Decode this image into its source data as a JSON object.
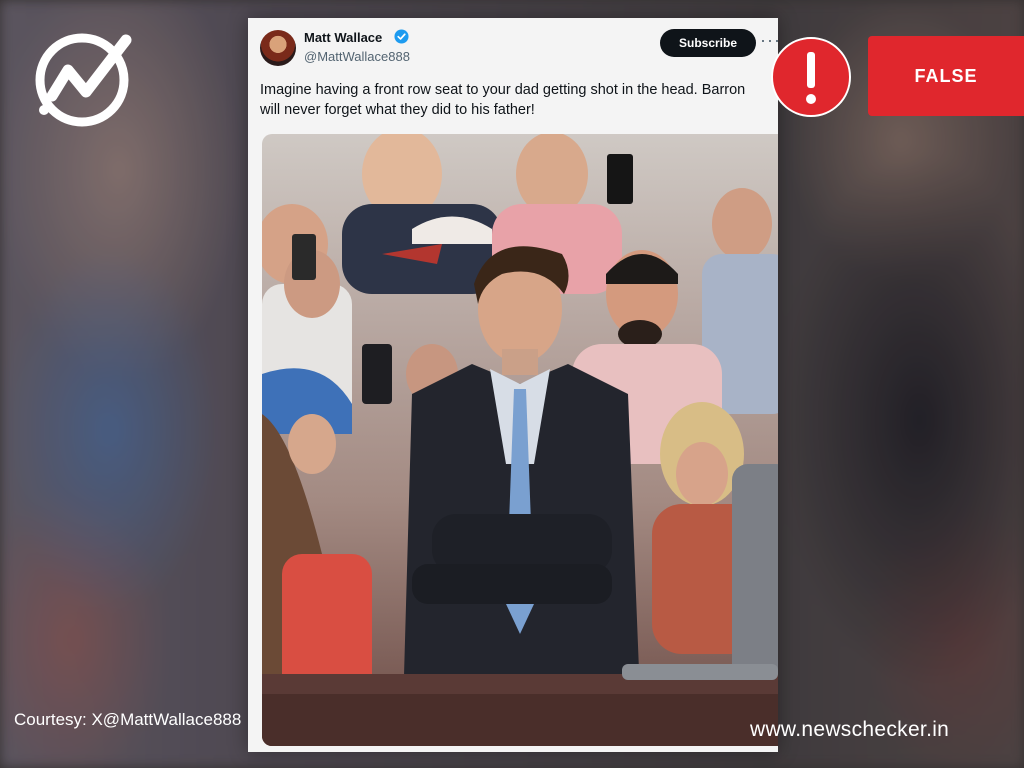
{
  "logo": {
    "icon": "newschecker-logo-icon",
    "color": "#ffffff"
  },
  "tweet": {
    "author_name": "Matt Wallace",
    "author_handle": "@MattWallace888",
    "verified_icon": "verified-badge-icon",
    "verified_color": "#1d9bf0",
    "subscribe_label": "Subscribe",
    "more_label": "···",
    "text": "Imagine having a front row seat to your dad getting shot in the head. Barron will never forget what they did to his father!"
  },
  "verdict": {
    "icon": "exclamation-icon",
    "label": "FALSE",
    "color": "#e0272d"
  },
  "footer": {
    "courtesy": "Courtesy: X@MattWallace888",
    "site": "www.newschecker.in"
  }
}
